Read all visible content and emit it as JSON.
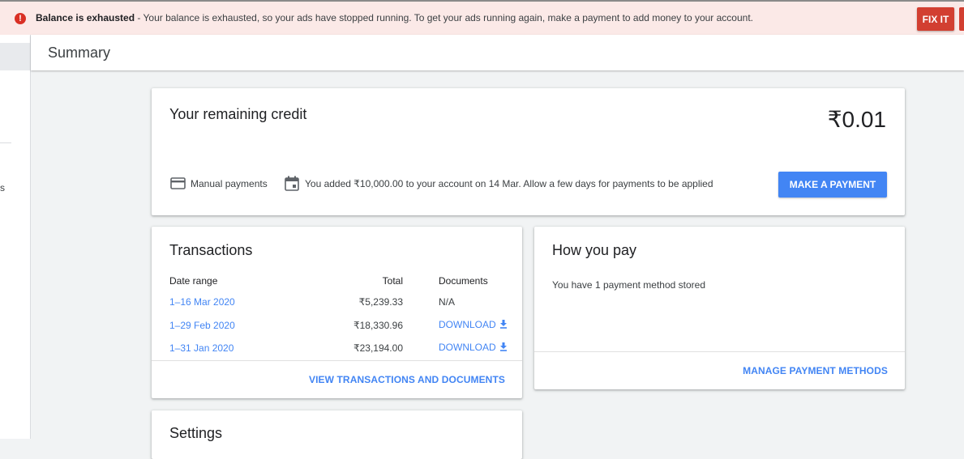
{
  "alert": {
    "icon": "error-icon",
    "title": "Balance is exhausted",
    "message": " - Your balance is exhausted, so your ads have stopped running. To get your ads running again, make a payment to add money to your account.",
    "fix_label": "FIX IT",
    "color": "#d23f31"
  },
  "sidebar": {
    "partial_label": "s"
  },
  "header": {
    "title": "Summary"
  },
  "credit": {
    "title": "Your remaining credit",
    "amount": "₹0.01",
    "payment_type": "Manual payments",
    "notice": "You added ₹10,000.00 to your account on 14 Mar. Allow a few days for payments to be applied",
    "pay_label": "MAKE A PAYMENT",
    "accent": "#4285f4"
  },
  "transactions": {
    "title": "Transactions",
    "columns": {
      "date": "Date range",
      "total": "Total",
      "documents": "Documents"
    },
    "rows": [
      {
        "date": "1–16 Mar 2020",
        "total": "₹5,239.33",
        "document": "N/A"
      },
      {
        "date": "1–29 Feb 2020",
        "total": "₹18,330.96",
        "document": "DOWNLOAD"
      },
      {
        "date": "1–31 Jan 2020",
        "total": "₹23,194.00",
        "document": "DOWNLOAD"
      }
    ],
    "footer_link": "VIEW TRANSACTIONS AND DOCUMENTS"
  },
  "how_you_pay": {
    "title": "How you pay",
    "text": "You have 1 payment method stored",
    "footer_link": "MANAGE PAYMENT METHODS"
  },
  "settings": {
    "title": "Settings"
  }
}
